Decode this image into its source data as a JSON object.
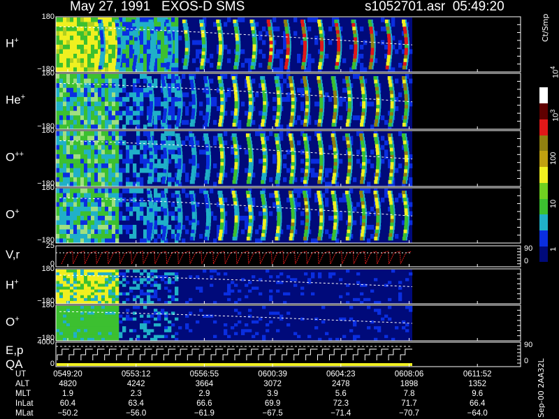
{
  "header": {
    "title": "May 27, 1991   EXOS-D SMS",
    "file_time": "s1052701.asr  05:49:20"
  },
  "colors": {
    "background": "#000000",
    "dark_blue": "#000a7a",
    "mid_blue": "#0a2ee0",
    "cyan": "#20b0c8",
    "green": "#3cc030",
    "yellow": "#f0f020",
    "olive": "#908010",
    "red": "#e01818",
    "white": "#ffffff"
  },
  "colorbar": {
    "units": "Ct/Smp",
    "labels": [
      "1",
      "10",
      "100",
      "10",
      "10"
    ],
    "label_exponents": [
      "",
      "",
      "",
      "3",
      "4"
    ],
    "levels": [
      1,
      10,
      100,
      1000,
      10000
    ],
    "colors": [
      "#000a7a",
      "#0a2ee0",
      "#20b0c8",
      "#3cc030",
      "#70d020",
      "#f0f020",
      "#c0a010",
      "#908010",
      "#e01818",
      "#600000",
      "#ffffff"
    ]
  },
  "chart_data": [
    {
      "type": "heatmap",
      "species": "H",
      "charge": "+",
      "y_ticks": [
        "180",
        "−180"
      ],
      "ylim": [
        -180,
        180
      ],
      "channels": 60,
      "spin_bursts": 19,
      "x_extent_fraction": 0.975
    },
    {
      "type": "heatmap",
      "species": "He",
      "charge": "+",
      "y_ticks": [
        "180",
        "−180"
      ],
      "ylim": [
        -180,
        180
      ],
      "channels": 60,
      "spin_bursts": 19,
      "x_extent_fraction": 0.975
    },
    {
      "type": "heatmap",
      "species": "O",
      "charge": "++",
      "y_ticks": [
        "180",
        "−180"
      ],
      "ylim": [
        -180,
        180
      ],
      "channels": 60,
      "spin_bursts": 19,
      "x_extent_fraction": 0.975
    },
    {
      "type": "heatmap",
      "species": "O",
      "charge": "+",
      "y_ticks": [
        "180",
        "−180"
      ],
      "ylim": [
        -180,
        180
      ],
      "channels": 60,
      "spin_bursts": 19,
      "x_extent_fraction": 0.975
    },
    {
      "type": "line",
      "species": "V,r",
      "y_ticks": [
        "25",
        "0"
      ],
      "right_ticks": [
        "90",
        "0"
      ],
      "ylim": [
        0,
        25
      ],
      "sawtooth_cycles": 30
    },
    {
      "type": "heatmap",
      "species": "H",
      "charge": "+",
      "y_ticks": [
        "180",
        "−180"
      ],
      "ylim": [
        -180,
        180
      ],
      "channels": 30,
      "spin_bursts": 0,
      "x_extent_fraction": 0.975
    },
    {
      "type": "heatmap",
      "species": "O",
      "charge": "+",
      "y_ticks": [
        "180",
        "−180"
      ],
      "ylim": [
        -180,
        180
      ],
      "channels": 30,
      "spin_bursts": 0,
      "x_extent_fraction": 0.975
    },
    {
      "type": "line",
      "species": "E,p",
      "species2": "QA",
      "y_ticks": [
        "4000",
        "0"
      ],
      "right_ticks": [
        "90",
        "0"
      ],
      "ylim": [
        0,
        4000
      ],
      "step_cycles": 30
    }
  ],
  "footer": {
    "rows": [
      {
        "label": "UT",
        "values": [
          "0549:20",
          "0553:12",
          "0556:55",
          "0600:39",
          "0604:23",
          "0608:06",
          "0611:52"
        ]
      },
      {
        "label": "ALT",
        "values": [
          "4820",
          "4242",
          "3664",
          "3072",
          "2478",
          "1898",
          "1352"
        ]
      },
      {
        "label": "MLT",
        "values": [
          "1.9",
          "2.3",
          "2.9",
          "3.9",
          "5.6",
          "7.8",
          "9.6"
        ]
      },
      {
        "label": "InLat",
        "values": [
          "60.4",
          "63.4",
          "66.6",
          "69.9",
          "72.3",
          "71.7",
          "66.4"
        ]
      },
      {
        "label": "MLat",
        "values": [
          "−50.2",
          "−56.0",
          "−61.9",
          "−67.5",
          "−71.4",
          "−70.7",
          "−64.0"
        ]
      }
    ],
    "processing_id": "Sep-00  2AA32L"
  }
}
